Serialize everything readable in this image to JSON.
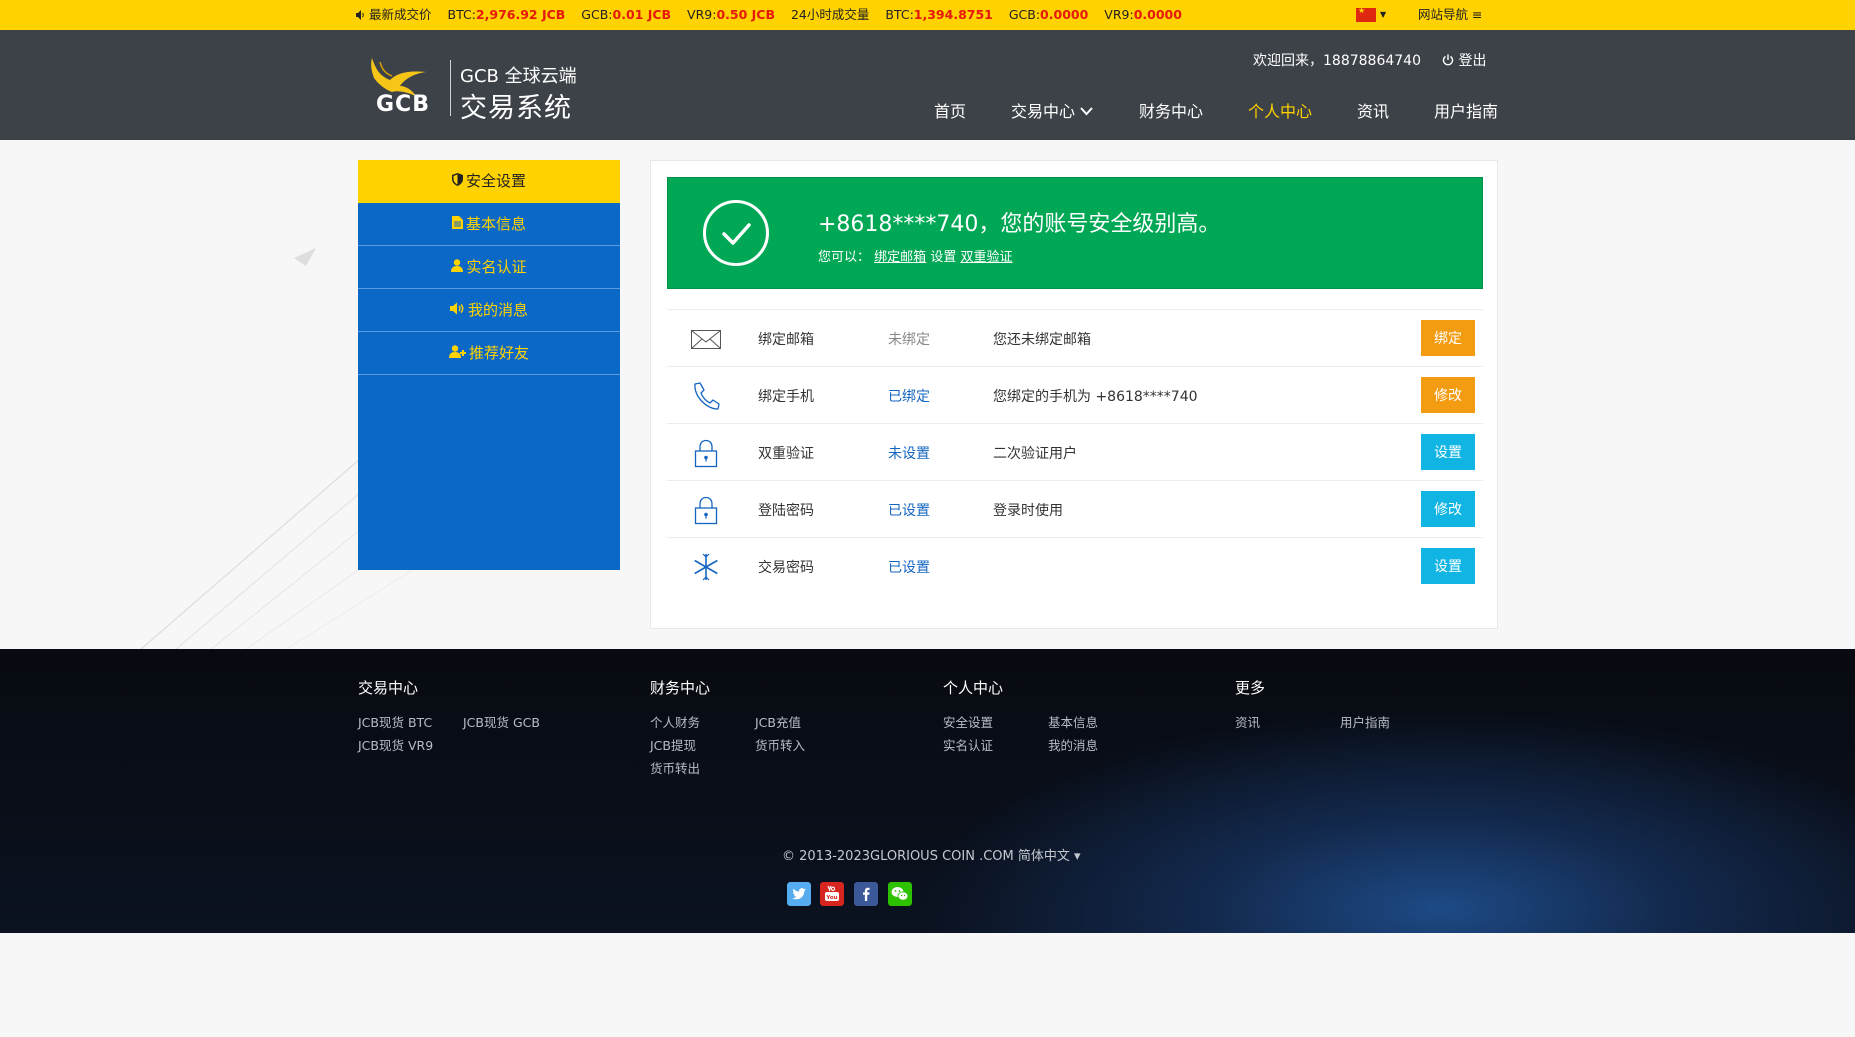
{
  "ticker": {
    "latest_label": "最新成交价",
    "btc_label": "BTC:",
    "btc_value": "2,976.92 JCB",
    "gcb_label": "GCB:",
    "gcb_value": "0.01 JCB",
    "vr9_label": "VR9:",
    "vr9_value": "0.50 JCB",
    "volume_label": "24小时成交量",
    "vol_btc_label": "BTC:",
    "vol_btc_value": "1,394.8751",
    "vol_gcb_label": "GCB:",
    "vol_gcb_value": "0.0000",
    "vol_vr9_label": "VR9:",
    "vol_vr9_value": "0.0000",
    "site_nav": "网站导航"
  },
  "header": {
    "logo_text": "GCB",
    "logo_line1": "GCB 全球云端",
    "logo_line2": "交易系统",
    "welcome": "欢迎回来，18878864740",
    "logout": "登出",
    "nav": [
      {
        "label": "首页"
      },
      {
        "label": "交易中心"
      },
      {
        "label": "财务中心"
      },
      {
        "label": "个人中心"
      },
      {
        "label": "资讯"
      },
      {
        "label": "用户指南"
      }
    ]
  },
  "sidebar": {
    "items": [
      {
        "label": "安全设置"
      },
      {
        "label": "基本信息"
      },
      {
        "label": "实名认证"
      },
      {
        "label": "我的消息"
      },
      {
        "label": "推荐好友"
      }
    ]
  },
  "banner": {
    "title": "+8618****740，您的账号安全级别高。",
    "you_can": "您可以：",
    "link1": "绑定邮箱",
    "mid": "设置",
    "link2": "双重验证"
  },
  "security_rows": [
    {
      "name": "绑定邮箱",
      "status": "未绑定",
      "desc": "您还未绑定邮箱",
      "button": "绑定"
    },
    {
      "name": "绑定手机",
      "status": "已绑定",
      "desc": "您绑定的手机为 +8618****740",
      "button": "修改"
    },
    {
      "name": "双重验证",
      "status": "未设置",
      "desc": "二次验证用户",
      "button": "设置"
    },
    {
      "name": "登陆密码",
      "status": "已设置",
      "desc": "登录时使用",
      "button": "修改"
    },
    {
      "name": "交易密码",
      "status": "已设置",
      "desc": "",
      "button": "设置"
    }
  ],
  "colors": {
    "accent_yellow": "#ffd200",
    "header_bg": "#3c4248",
    "sidebar_blue": "#0b68c7",
    "success_green": "#00a855",
    "btn_orange": "#f39c12",
    "btn_cyan": "#10b5e3",
    "status_blue": "#1565c0",
    "status_gray": "#888888"
  },
  "footer": {
    "cols": [
      {
        "heading": "交易中心",
        "links": [
          "JCB现货 BTC",
          "JCB现货 GCB",
          "JCB现货 VR9"
        ]
      },
      {
        "heading": "财务中心",
        "links": [
          "个人财务",
          "JCB充值",
          "JCB提现",
          "货币转入",
          "货币转出"
        ]
      },
      {
        "heading": "个人中心",
        "links": [
          "安全设置",
          "基本信息",
          "实名认证",
          "我的消息"
        ]
      },
      {
        "heading": "更多",
        "links": [
          "资讯",
          "用户指南"
        ]
      }
    ],
    "copyright": "© 2013-2023GLORIOUS COIN .COM 简体中文 ▾",
    "social": [
      "twitter-icon",
      "youtube-icon",
      "facebook-icon",
      "wechat-icon"
    ]
  }
}
